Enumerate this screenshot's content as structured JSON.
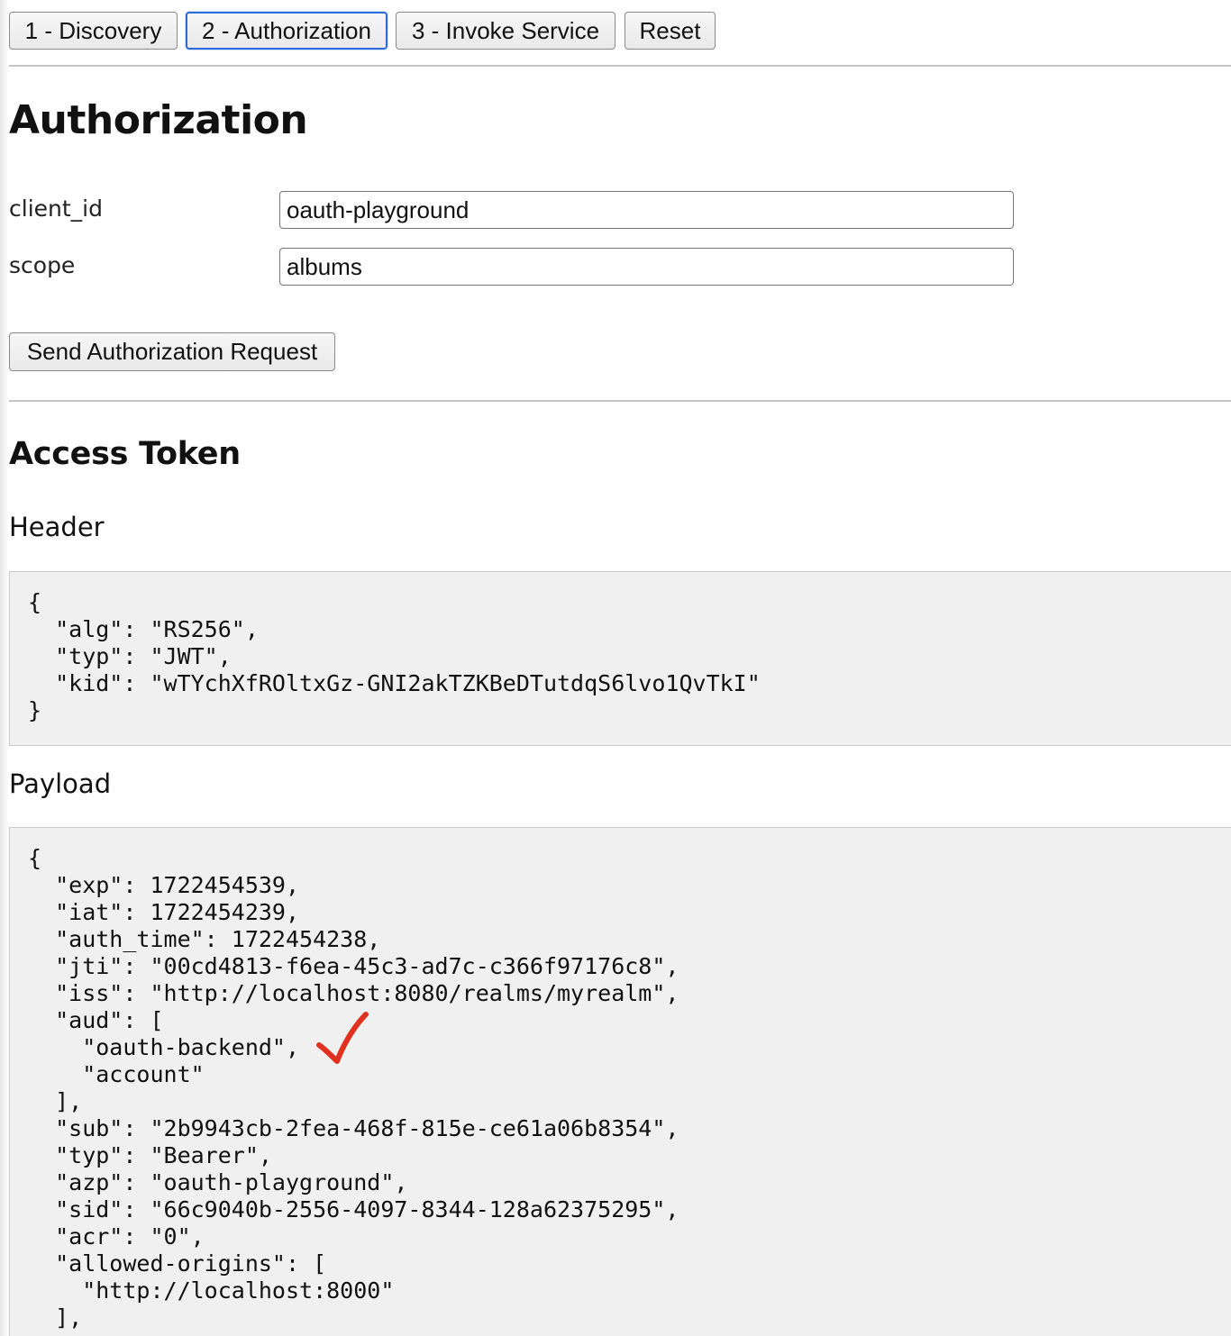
{
  "tabs": [
    {
      "label": "1 - Discovery",
      "active": false
    },
    {
      "label": "2 - Authorization",
      "active": true
    },
    {
      "label": "3 - Invoke Service",
      "active": false
    },
    {
      "label": "Reset",
      "active": false
    }
  ],
  "authorization": {
    "title": "Authorization",
    "fields": [
      {
        "label": "client_id",
        "value": "oauth-playground"
      },
      {
        "label": "scope",
        "value": "albums"
      }
    ],
    "send_button_label": "Send Authorization Request"
  },
  "access_token": {
    "title": "Access Token",
    "header_label": "Header",
    "header_json": "{\n  \"alg\": \"RS256\",\n  \"typ\": \"JWT\",\n  \"kid\": \"wTYchXfROltxGz-GNI2akTZKBeDTutdqS6lvo1QvTkI\"\n}",
    "payload_label": "Payload",
    "payload_json": "{\n  \"exp\": 1722454539,\n  \"iat\": 1722454239,\n  \"auth_time\": 1722454238,\n  \"jti\": \"00cd4813-f6ea-45c3-ad7c-c366f97176c8\",\n  \"iss\": \"http://localhost:8080/realms/myrealm\",\n  \"aud\": [\n    \"oauth-backend\",\n    \"account\"\n  ],\n  \"sub\": \"2b9943cb-2fea-468f-815e-ce61a06b8354\",\n  \"typ\": \"Bearer\",\n  \"azp\": \"oauth-playground\",\n  \"sid\": \"66c9040b-2556-4097-8344-128a62375295\",\n  \"acr\": \"0\",\n  \"allowed-origins\": [\n    \"http://localhost:8000\"\n  ],"
  },
  "annotation": {
    "icon": "checkmark-icon",
    "color": "#e0301e"
  },
  "colors": {
    "active_tab_border": "#2d6bd6",
    "code_background": "#f0f0f0"
  }
}
